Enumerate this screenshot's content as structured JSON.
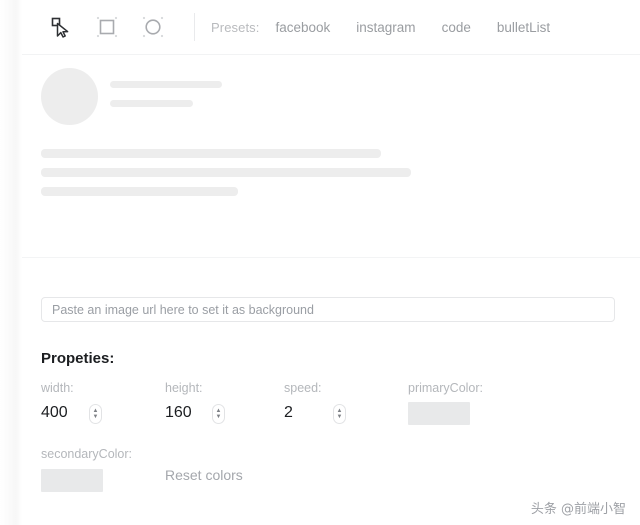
{
  "toolbar": {
    "tools": [
      {
        "name": "pointer-select-tool",
        "icon": "cursor-select-icon",
        "active": true
      },
      {
        "name": "rect-tool",
        "icon": "square-shape-icon",
        "active": false
      },
      {
        "name": "circle-tool",
        "icon": "circle-shape-icon",
        "active": false
      }
    ],
    "presets_label": "Presets:",
    "presets": [
      {
        "label": "facebook"
      },
      {
        "label": "instagram"
      },
      {
        "label": "code"
      },
      {
        "label": "bulletList"
      }
    ]
  },
  "preview": {
    "skeleton_color": "#ededed"
  },
  "background_url": {
    "value": "",
    "placeholder": "Paste an image url here to set it as background"
  },
  "properties": {
    "title": "Propeties:",
    "width": {
      "label": "width:",
      "value": "400"
    },
    "height": {
      "label": "height:",
      "value": "160"
    },
    "speed": {
      "label": "speed:",
      "value": "2"
    },
    "primaryColor": {
      "label": "primaryColor:",
      "color": "#e8e9ea"
    },
    "secondaryColor": {
      "label": "secondaryColor:",
      "color": "#e8e9ea"
    },
    "reset_label": "Reset colors"
  },
  "watermark": {
    "text": "头条 @前端小智"
  }
}
